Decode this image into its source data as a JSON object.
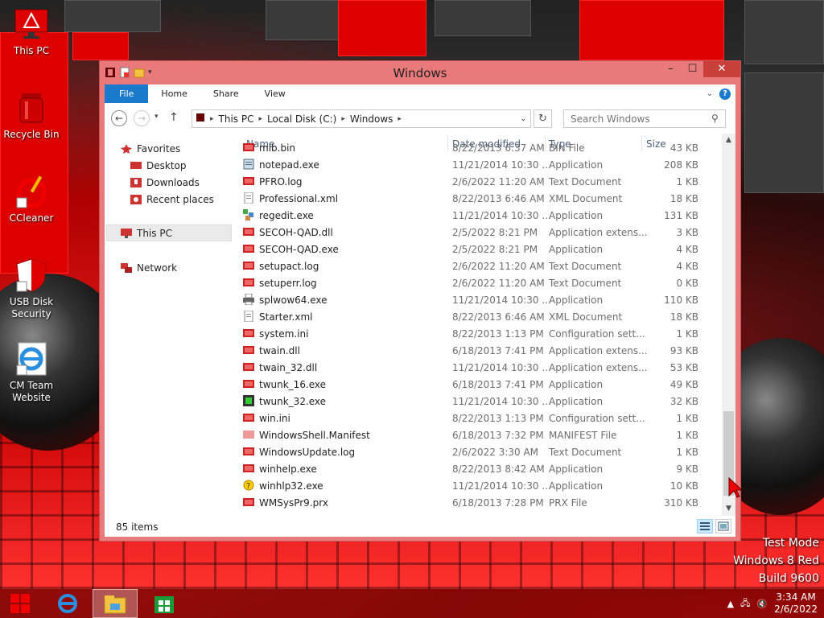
{
  "desktop": {
    "icons": [
      {
        "label": "This PC"
      },
      {
        "label": "Recycle Bin"
      },
      {
        "label": "CCleaner"
      },
      {
        "label": "USB Disk Security"
      },
      {
        "label": "CM Team Website"
      }
    ]
  },
  "window": {
    "title": "Windows",
    "ribbon_tabs": [
      "File",
      "Home",
      "Share",
      "View"
    ],
    "address": [
      "This PC",
      "Local Disk (C:)",
      "Windows"
    ],
    "search_placeholder": "Search Windows",
    "status": "85 items"
  },
  "navpane": {
    "favorites": "Favorites",
    "favorites_items": [
      "Desktop",
      "Downloads",
      "Recent places"
    ],
    "this_pc": "This PC",
    "network": "Network"
  },
  "columns": {
    "name": "Name",
    "date": "Date modified",
    "type": "Type",
    "size": "Size"
  },
  "files": [
    {
      "name": "mib.bin",
      "date": "8/22/2013 6:37 AM",
      "type": "BIN File",
      "size": "43 KB",
      "icon": "red"
    },
    {
      "name": "notepad.exe",
      "date": "11/21/2014 10:30 ...",
      "type": "Application",
      "size": "208 KB",
      "icon": "notepad"
    },
    {
      "name": "PFRO.log",
      "date": "2/6/2022 11:20 AM",
      "type": "Text Document",
      "size": "1 KB",
      "icon": "red"
    },
    {
      "name": "Professional.xml",
      "date": "8/22/2013 6:46 AM",
      "type": "XML Document",
      "size": "18 KB",
      "icon": "doc"
    },
    {
      "name": "regedit.exe",
      "date": "11/21/2014 10:30 ...",
      "type": "Application",
      "size": "131 KB",
      "icon": "regedit"
    },
    {
      "name": "SECOH-QAD.dll",
      "date": "2/5/2022 8:21 PM",
      "type": "Application extens...",
      "size": "3 KB",
      "icon": "red"
    },
    {
      "name": "SECOH-QAD.exe",
      "date": "2/5/2022 8:21 PM",
      "type": "Application",
      "size": "4 KB",
      "icon": "red"
    },
    {
      "name": "setupact.log",
      "date": "2/6/2022 11:20 AM",
      "type": "Text Document",
      "size": "4 KB",
      "icon": "red"
    },
    {
      "name": "setuperr.log",
      "date": "2/6/2022 11:20 AM",
      "type": "Text Document",
      "size": "0 KB",
      "icon": "red"
    },
    {
      "name": "splwow64.exe",
      "date": "11/21/2014 10:30 ...",
      "type": "Application",
      "size": "110 KB",
      "icon": "printer"
    },
    {
      "name": "Starter.xml",
      "date": "8/22/2013 6:46 AM",
      "type": "XML Document",
      "size": "18 KB",
      "icon": "doc"
    },
    {
      "name": "system.ini",
      "date": "8/22/2013 1:13 PM",
      "type": "Configuration sett...",
      "size": "1 KB",
      "icon": "red"
    },
    {
      "name": "twain.dll",
      "date": "6/18/2013 7:41 PM",
      "type": "Application extens...",
      "size": "93 KB",
      "icon": "red"
    },
    {
      "name": "twain_32.dll",
      "date": "11/21/2014 10:30 ...",
      "type": "Application extens...",
      "size": "53 KB",
      "icon": "red"
    },
    {
      "name": "twunk_16.exe",
      "date": "6/18/2013 7:41 PM",
      "type": "Application",
      "size": "49 KB",
      "icon": "red"
    },
    {
      "name": "twunk_32.exe",
      "date": "11/21/2014 10:30 ...",
      "type": "Application",
      "size": "32 KB",
      "icon": "green"
    },
    {
      "name": "win.ini",
      "date": "8/22/2013 1:13 PM",
      "type": "Configuration sett...",
      "size": "1 KB",
      "icon": "red"
    },
    {
      "name": "WindowsShell.Manifest",
      "date": "6/18/2013 7:32 PM",
      "type": "MANIFEST File",
      "size": "1 KB",
      "icon": "pink"
    },
    {
      "name": "WindowsUpdate.log",
      "date": "2/6/2022 3:30 AM",
      "type": "Text Document",
      "size": "1 KB",
      "icon": "red"
    },
    {
      "name": "winhelp.exe",
      "date": "8/22/2013 8:42 AM",
      "type": "Application",
      "size": "9 KB",
      "icon": "red"
    },
    {
      "name": "winhlp32.exe",
      "date": "11/21/2014 10:30 ...",
      "type": "Application",
      "size": "10 KB",
      "icon": "help"
    },
    {
      "name": "WMSysPr9.prx",
      "date": "6/18/2013 7:28 PM",
      "type": "PRX File",
      "size": "310 KB",
      "icon": "red"
    }
  ],
  "watermark": [
    "Test Mode",
    "Windows 8 Red",
    "Build 9600"
  ],
  "taskbar": {
    "time": "3:34 AM",
    "date": "2/6/2022"
  },
  "colors": {
    "file_tab": "#1979ca",
    "window_frame": "#e9797a",
    "close_button": "#c9403a"
  }
}
